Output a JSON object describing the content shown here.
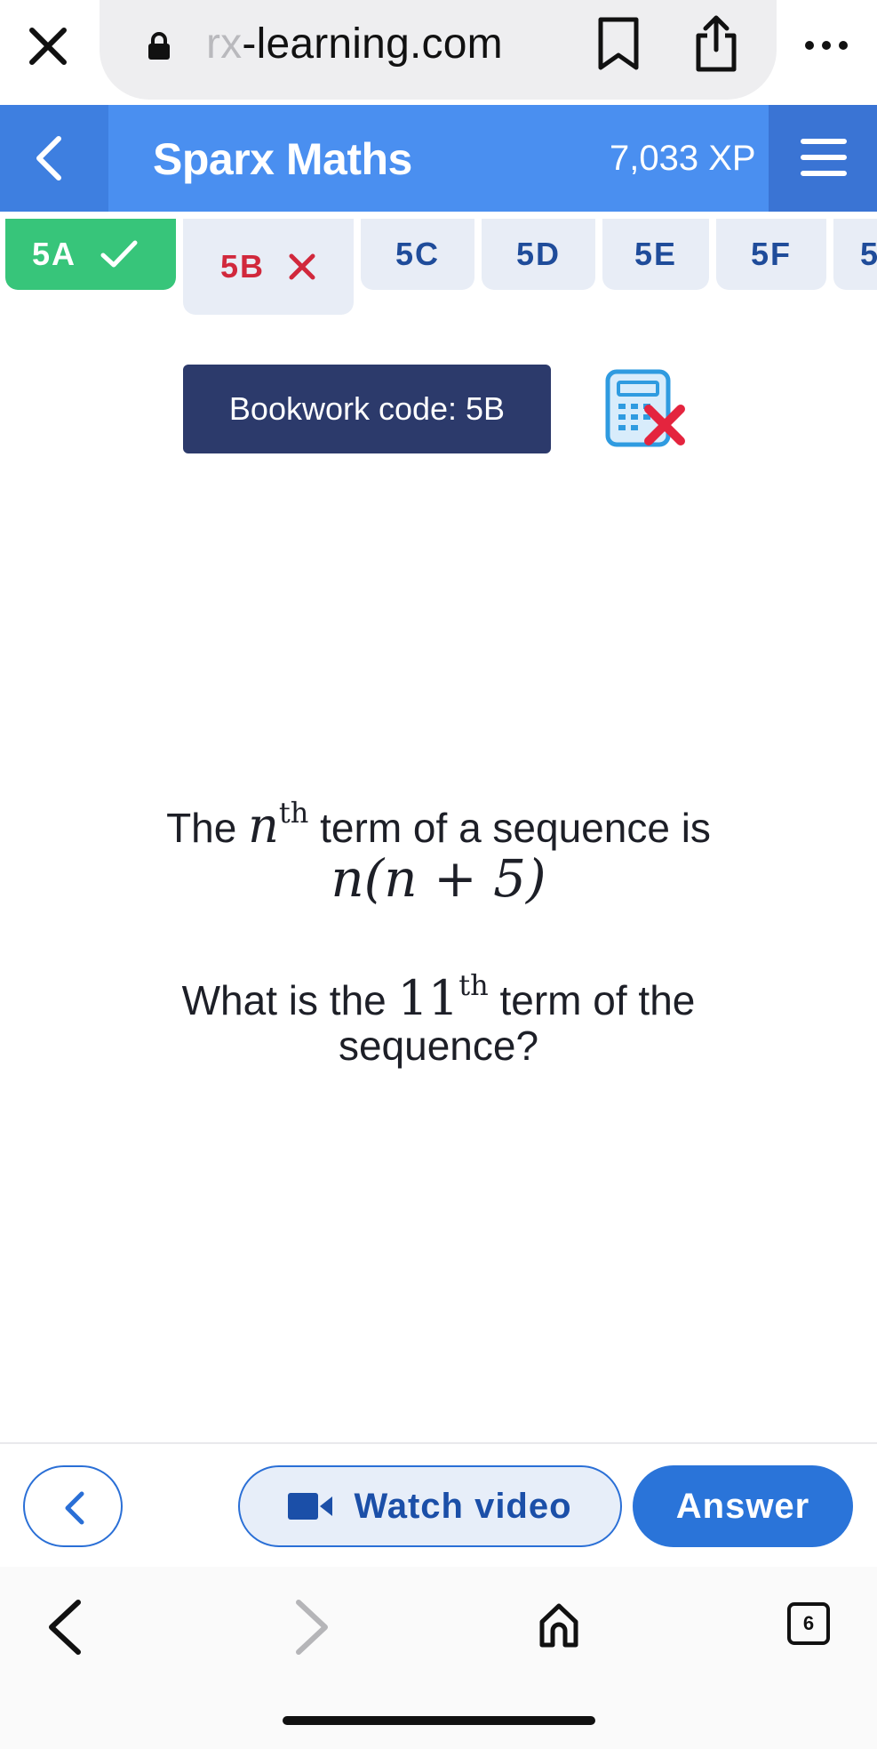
{
  "browser": {
    "url_prefix": "rx",
    "url_main": "-learning.com",
    "icons": [
      "close-icon",
      "lock-icon",
      "bookmark-icon",
      "share-icon",
      "more-icon"
    ]
  },
  "header": {
    "title": "Sparx Maths",
    "xp": "7,033 XP",
    "colors": {
      "header": "#4a8ff0",
      "back": "#3e7fe0",
      "menu": "#3a74d4"
    }
  },
  "tabs": [
    {
      "label": "5A",
      "status": "correct"
    },
    {
      "label": "5B",
      "status": "incorrect",
      "current": true
    },
    {
      "label": "5C"
    },
    {
      "label": "5D"
    },
    {
      "label": "5E"
    },
    {
      "label": "5F"
    },
    {
      "label": "5"
    }
  ],
  "bookwork": {
    "label": "Bookwork code: 5B",
    "calculator": "not-allowed"
  },
  "question": {
    "line1_pre": "The",
    "line1_var": "n",
    "line1_sup": "th",
    "line1_post": "term of a sequence is",
    "expression": "n(n + 5)",
    "line2_pre": "What is the",
    "line2_num": "11",
    "line2_sup": "th",
    "line2_post": "term of the",
    "line3": "sequence?"
  },
  "actions": {
    "video_label": "Watch video",
    "answer_label": "Answer"
  },
  "bottom_nav": {
    "tab_count": "6"
  }
}
